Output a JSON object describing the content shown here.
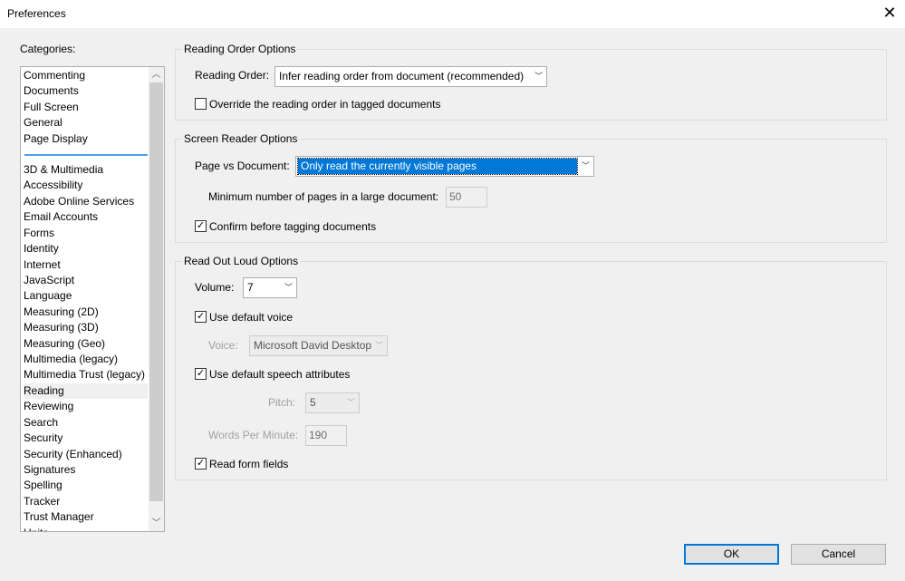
{
  "window": {
    "title": "Preferences",
    "close_icon": "close-icon"
  },
  "categories": {
    "label": "Categories:",
    "group1": [
      "Commenting",
      "Documents",
      "Full Screen",
      "General",
      "Page Display"
    ],
    "group2": [
      "3D & Multimedia",
      "Accessibility",
      "Adobe Online Services",
      "Email Accounts",
      "Forms",
      "Identity",
      "Internet",
      "JavaScript",
      "Language",
      "Measuring (2D)",
      "Measuring (3D)",
      "Measuring (Geo)",
      "Multimedia (legacy)",
      "Multimedia Trust (legacy)",
      "Reading",
      "Reviewing",
      "Search",
      "Security",
      "Security (Enhanced)",
      "Signatures",
      "Spelling",
      "Tracker",
      "Trust Manager",
      "Units"
    ],
    "selected": "Reading"
  },
  "reading_order": {
    "legend": "Reading Order Options",
    "label": "Reading Order:",
    "value": "Infer reading order from document (recommended)",
    "override_label": "Override the reading order in tagged documents",
    "override_checked": false
  },
  "screen_reader": {
    "legend": "Screen Reader Options",
    "page_vs_doc_label": "Page vs Document:",
    "page_vs_doc_value": "Only read the currently visible pages",
    "min_pages_label": "Minimum number of pages in a large document:",
    "min_pages_value": "50",
    "confirm_label": "Confirm before tagging documents",
    "confirm_checked": true
  },
  "read_out_loud": {
    "legend": "Read Out Loud Options",
    "volume_label": "Volume:",
    "volume_value": "7",
    "default_voice_label": "Use default voice",
    "default_voice_checked": true,
    "voice_label": "Voice:",
    "voice_value": "Microsoft David Desktop",
    "default_speech_label": "Use default speech attributes",
    "default_speech_checked": true,
    "pitch_label": "Pitch:",
    "pitch_value": "5",
    "wpm_label": "Words Per Minute:",
    "wpm_value": "190",
    "read_form_label": "Read form fields",
    "read_form_checked": true
  },
  "buttons": {
    "ok": "OK",
    "cancel": "Cancel"
  },
  "colors": {
    "accent": "#0078d7"
  }
}
